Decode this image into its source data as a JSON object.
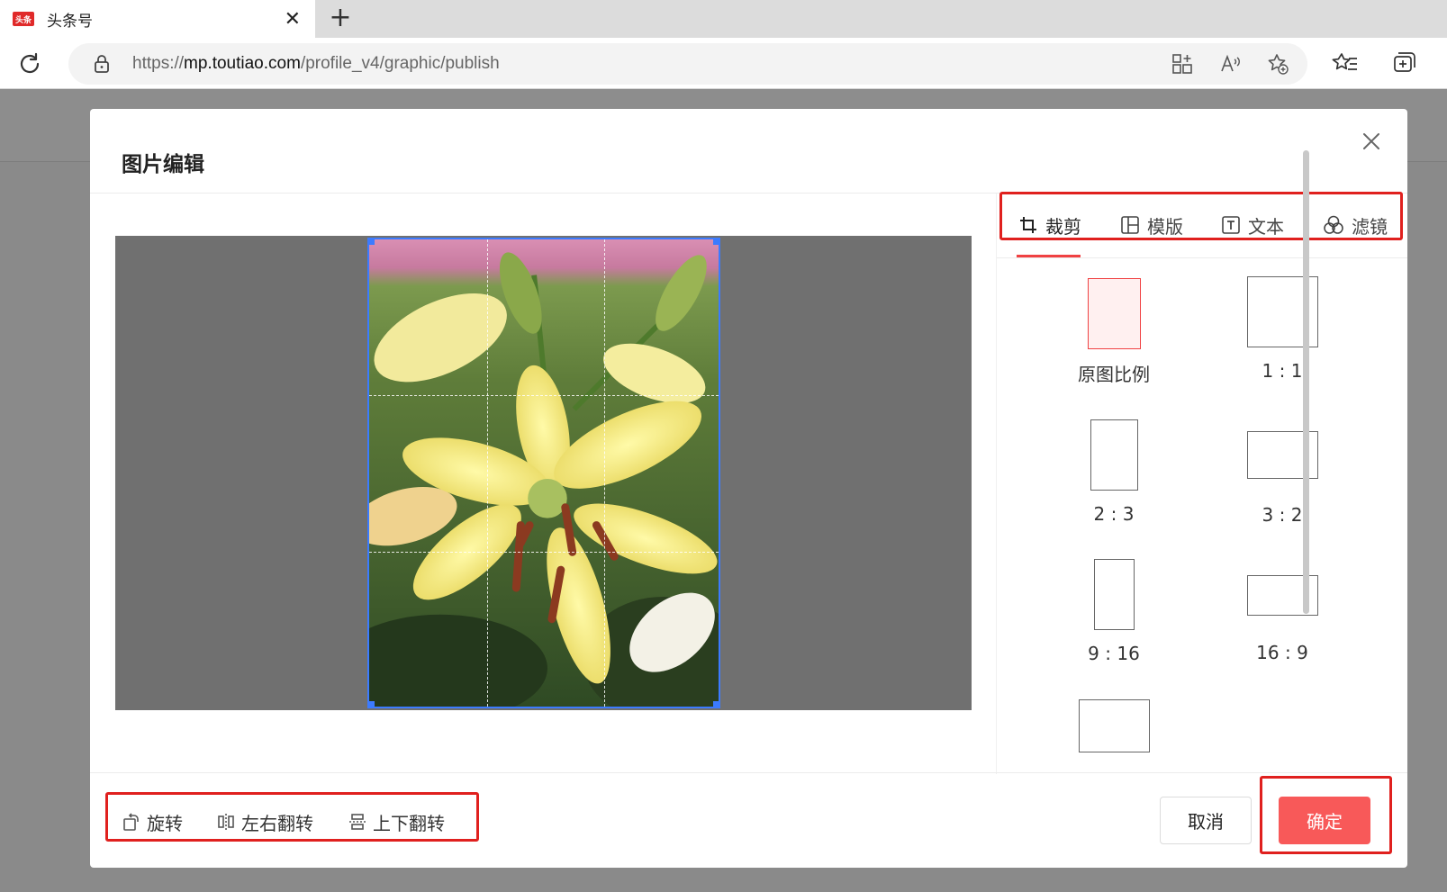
{
  "browser": {
    "tab": {
      "favicon_text": "头条",
      "title": "头条号"
    },
    "url_prefix": "https://",
    "url_host": "mp.toutiao.com",
    "url_path": "/profile_v4/graphic/publish"
  },
  "modal": {
    "title": "图片编辑",
    "tabs": [
      {
        "label": "裁剪",
        "icon": "crop-icon",
        "active": true
      },
      {
        "label": "模版",
        "icon": "template-icon",
        "active": false
      },
      {
        "label": "文本",
        "icon": "text-icon",
        "active": false
      },
      {
        "label": "滤镜",
        "icon": "filter-icon",
        "active": false
      }
    ],
    "ratios": [
      {
        "label": "原图比例",
        "selected": true
      },
      {
        "label": "1 : 1",
        "selected": false
      },
      {
        "label": "2 : 3",
        "selected": false
      },
      {
        "label": "3 : 2",
        "selected": false
      },
      {
        "label": "9 : 16",
        "selected": false
      },
      {
        "label": "16 : 9",
        "selected": false
      },
      {
        "label": "",
        "selected": false
      }
    ],
    "tools": [
      {
        "label": "旋转",
        "icon": "rotate-icon"
      },
      {
        "label": "左右翻转",
        "icon": "flip-horizontal-icon"
      },
      {
        "label": "上下翻转",
        "icon": "flip-vertical-icon"
      }
    ],
    "cancel_label": "取消",
    "confirm_label": "确定"
  },
  "colors": {
    "accent": "#f04142",
    "confirm_button": "#f85959",
    "highlight_box": "#e0201e",
    "crop_frame": "#3c7bff"
  }
}
